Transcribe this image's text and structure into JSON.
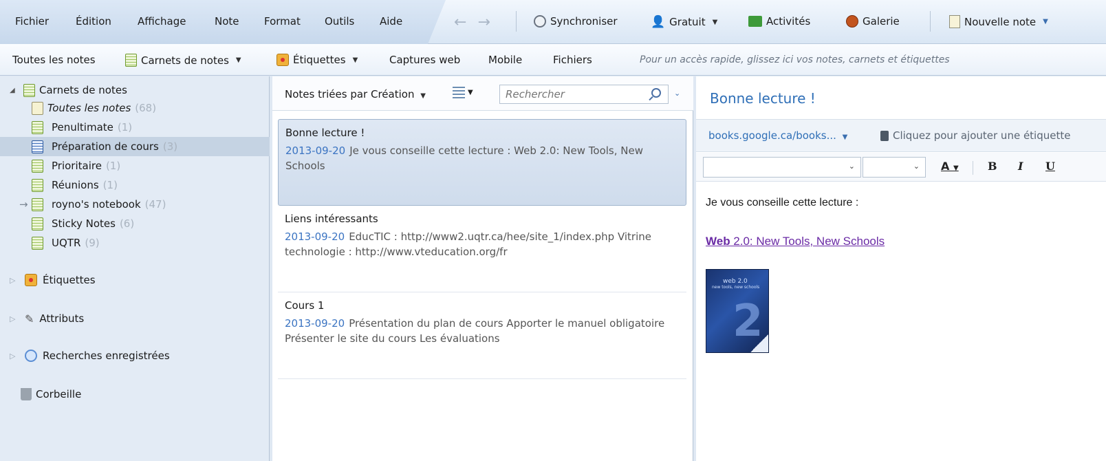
{
  "menu": [
    "Fichier",
    "Édition",
    "Affichage",
    "Note",
    "Format",
    "Outils",
    "Aide"
  ],
  "toolbar": {
    "sync": "Synchroniser",
    "account": "Gratuit",
    "activities": "Activités",
    "gallery": "Galerie",
    "new_note": "Nouvelle note"
  },
  "shortcuts": {
    "all_notes": "Toutes les notes",
    "notebooks": "Carnets de notes",
    "tags": "Étiquettes",
    "web_clips": "Captures web",
    "mobile": "Mobile",
    "files": "Fichiers",
    "hint": "Pour un accès rapide, glissez ici vos notes, carnets et étiquettes"
  },
  "sidebar": {
    "root": "Carnets de notes",
    "notebooks": [
      {
        "label": "Toutes les notes",
        "count": "(68)"
      },
      {
        "label": "Penultimate",
        "count": "(1)"
      },
      {
        "label": "Préparation de cours",
        "count": "(3)"
      },
      {
        "label": "Prioritaire",
        "count": "(1)"
      },
      {
        "label": "Réunions",
        "count": "(1)"
      },
      {
        "label": "royno's notebook",
        "count": "(47)"
      },
      {
        "label": "Sticky Notes",
        "count": "(6)"
      },
      {
        "label": "UQTR",
        "count": "(9)"
      }
    ],
    "tags": "Étiquettes",
    "attributes": "Attributs",
    "saved_searches": "Recherches enregistrées",
    "trash": "Corbeille"
  },
  "list": {
    "sort_label": "Notes triées par Création",
    "search_placeholder": "Rechercher",
    "notes": [
      {
        "title": "Bonne lecture !",
        "date": "2013-09-20",
        "snippet": "Je vous conseille cette lecture : Web 2.0: New Tools, New Schools"
      },
      {
        "title": "Liens intéressants",
        "date": "2013-09-20",
        "snippet": "EducTIC : http://www2.uqtr.ca/hee/site_1/index.php Vitrine technologie : http://www.vteducation.org/fr"
      },
      {
        "title": "Cours 1",
        "date": "2013-09-20",
        "snippet": "Présentation du plan de cours Apporter le manuel obligatoire Présenter le site du cours Les évaluations"
      }
    ]
  },
  "editor": {
    "title": "Bonne lecture !",
    "source_url": "books.google.ca/books...",
    "tag_prompt": "Cliquez pour ajouter une étiquette",
    "body_text": "Je vous conseille cette lecture :",
    "link_bold": "Web",
    "link_rest": " 2.0: New Tools, New Schools",
    "cover_text": "web 2.0",
    "cover_sub": "new tools, new schools"
  },
  "colors": {
    "accent": "#2f6fb7",
    "date": "#3b74c2",
    "link_visited": "#6a2aa5",
    "selection": "#c5d3e3"
  }
}
